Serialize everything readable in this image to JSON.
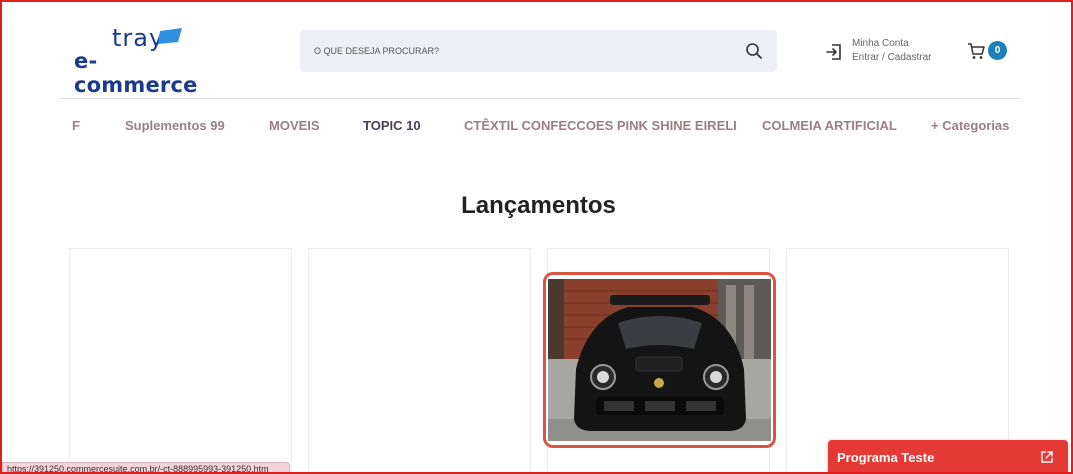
{
  "header": {
    "logo_top": "tray",
    "logo_bottom": "e-commerce",
    "search_placeholder": "O QUE DESEJA PROCURAR?",
    "account_line1": "Minha Conta",
    "account_line2": "Entrar / Cadastrar",
    "cart_count": "0"
  },
  "nav": {
    "items": [
      {
        "label": "F"
      },
      {
        "label": "Suplementos 99"
      },
      {
        "label": "MOVEIS"
      },
      {
        "label": "TOPIC 10"
      },
      {
        "label": "CTÊXTIL CONFECCOES PINK SHINE EIRELI"
      },
      {
        "label": "COLMEIA ARTIFICIAL"
      },
      {
        "label": "+ Categorias"
      }
    ]
  },
  "section": {
    "title": "Lançamentos"
  },
  "status_url": "https://391250.commercesuite.com.br/-ct-888995993-391250.htm",
  "promo": {
    "label": "Programa Teste"
  },
  "colors": {
    "brand": "#1b3a8c",
    "accent": "#e53935",
    "badge": "#1d7fb8"
  }
}
